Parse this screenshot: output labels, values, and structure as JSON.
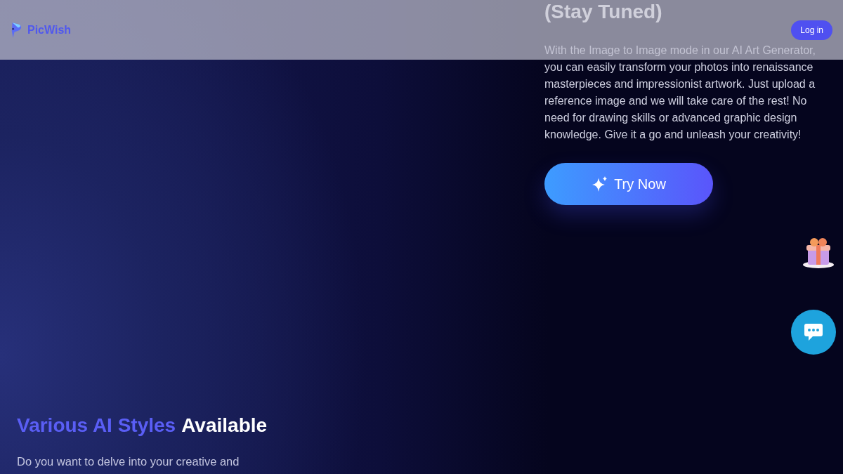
{
  "header": {
    "logo": "PicWish",
    "login": "Log in"
  },
  "feature": {
    "heading": "(Stay Tuned)",
    "body": "With the Image to Image mode in our AI Art Generator, you can easily transform your photos into renaissance masterpieces and impressionist artwork. Just upload a reference image and we will take care of the rest! No need for drawing skills or advanced graphic design knowledge. Give it a go and unleash your creativity!",
    "button": "Try Now"
  },
  "styles_section": {
    "heading_highlight": "Various AI Styles",
    "heading_rest": "Available",
    "body": "Do you want to delve into your creative and"
  }
}
